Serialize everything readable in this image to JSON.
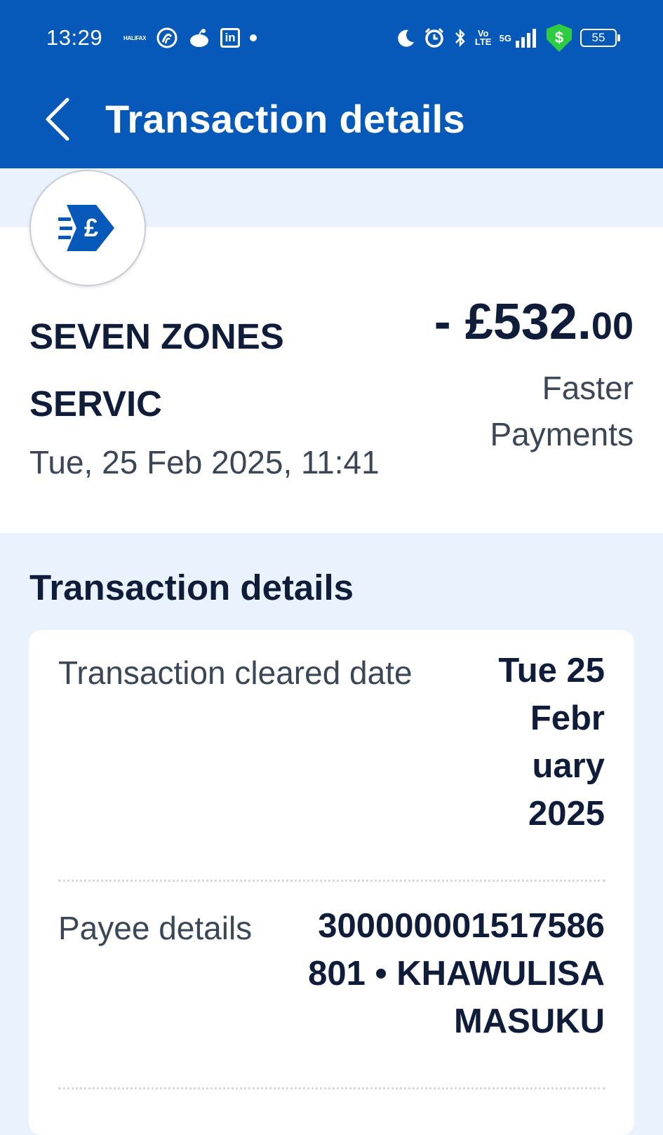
{
  "status_bar": {
    "time": "13:29",
    "halifax_icon_text": "HALIFAX",
    "linkedin_text": "in",
    "volte_text": "Vo LTE",
    "network_text": "5G",
    "shield_symbol": "$",
    "battery": "55"
  },
  "header": {
    "title": "Transaction details"
  },
  "summary": {
    "merchant_line1": "SEVEN ZONES",
    "merchant_line2": "SERVIC",
    "amount_main": "- £532.",
    "amount_pence": "00",
    "method_line1": "Faster",
    "method_line2": "Payments",
    "date": "Tue, 25 Feb 2025, 11:41"
  },
  "details": {
    "heading": "Transaction details",
    "rows": [
      {
        "label": "Transaction cleared date",
        "value_lines": [
          "Tue 25",
          "Febr",
          "uary",
          "2025"
        ]
      },
      {
        "label": "Payee details",
        "value_lines": [
          "300000001517586",
          "801 • KHAWULISA",
          "MASUKU"
        ]
      }
    ]
  },
  "colors": {
    "brand_blue": "#0659b9",
    "page_bg": "#eaf3fd",
    "text_dark": "#0f1d3a",
    "text_muted": "#3b4656"
  }
}
